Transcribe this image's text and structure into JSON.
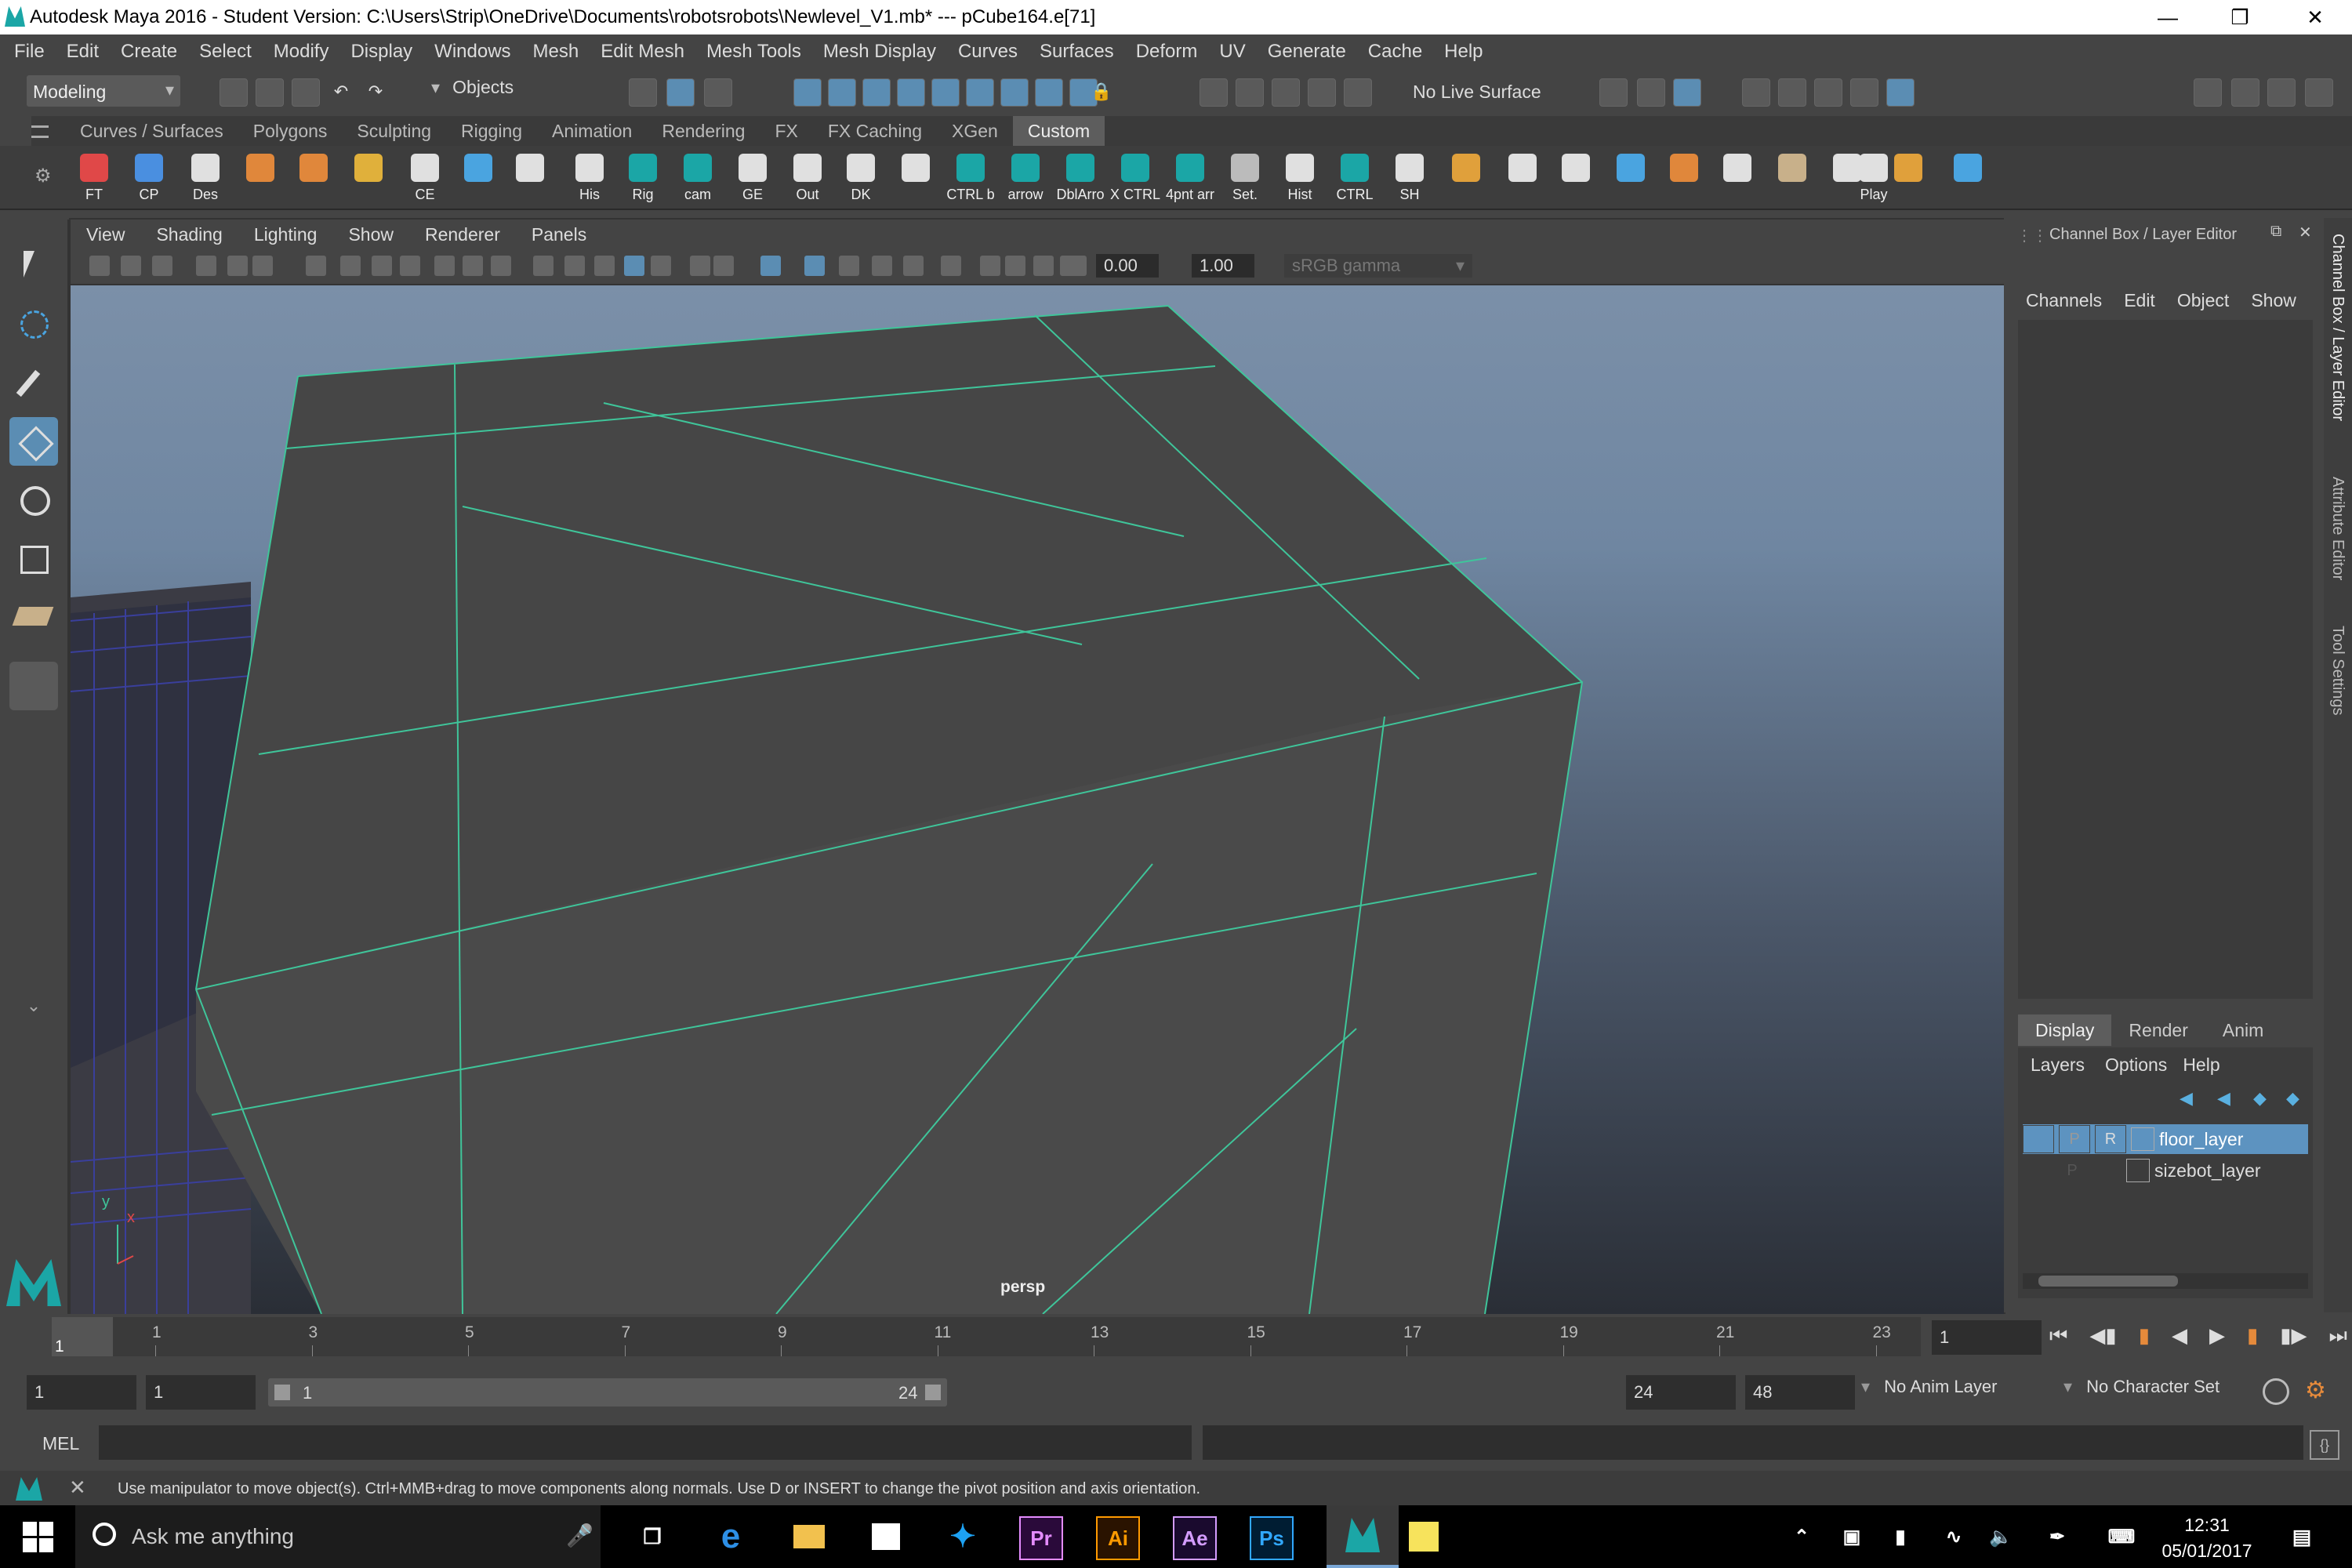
{
  "window": {
    "title": "Autodesk Maya 2016 - Student Version: C:\\Users\\Strip\\OneDrive\\Documents\\robotsrobots\\Newlevel_V1.mb*   ---   pCube164.e[71]"
  },
  "menubar": [
    "File",
    "Edit",
    "Create",
    "Select",
    "Modify",
    "Display",
    "Windows",
    "Mesh",
    "Edit Mesh",
    "Mesh Tools",
    "Mesh Display",
    "Curves",
    "Surfaces",
    "Deform",
    "UV",
    "Generate",
    "Cache",
    "Help"
  ],
  "status_line": {
    "mode": "Modeling",
    "selection_mode": "Objects",
    "live_surface": "No Live Surface"
  },
  "shelf_tabs": [
    "Curves / Surfaces",
    "Polygons",
    "Sculpting",
    "Rigging",
    "Animation",
    "Rendering",
    "FX",
    "FX Caching",
    "XGen",
    "Custom"
  ],
  "shelf_tabs_active": "Custom",
  "shelf_buttons": [
    "FT",
    "CP",
    "Des",
    "",
    "",
    "",
    "CE",
    "",
    "",
    "His",
    "Rig",
    "cam",
    "GE",
    "Out",
    "DK",
    "",
    "CTRL b",
    "arrow",
    "DblArro",
    "X CTRL",
    "4pnt arr",
    "Set.",
    "Hist",
    "CTRL",
    "SH",
    "",
    "",
    "",
    "",
    "",
    "",
    "",
    "",
    "Play",
    "",
    ""
  ],
  "viewport": {
    "menu": [
      "View",
      "Shading",
      "Lighting",
      "Show",
      "Renderer",
      "Panels"
    ],
    "exposure": "0.00",
    "gamma": "1.00",
    "color_space": "sRGB gamma",
    "camera_label": "persp",
    "axis_y": "y",
    "axis_x": "x"
  },
  "channel_box": {
    "title": "Channel Box / Layer Editor",
    "menu": [
      "Channels",
      "Edit",
      "Object",
      "Show"
    ],
    "layer_tabs": [
      "Display",
      "Render",
      "Anim"
    ],
    "layer_tabs_active": "Display",
    "layer_menu": [
      "Layers",
      "Options",
      "Help"
    ],
    "layers": [
      {
        "v": "",
        "p": "P",
        "r": "R",
        "name": "floor_layer",
        "selected": true
      },
      {
        "v": "",
        "p": "P",
        "r": "",
        "name": "sizebot_layer",
        "selected": false
      }
    ]
  },
  "side_tabs": [
    "Channel Box / Layer Editor",
    "Attribute Editor",
    "Tool Settings"
  ],
  "timeline": {
    "ticks": [
      "1",
      "3",
      "5",
      "7",
      "9",
      "11",
      "13",
      "15",
      "17",
      "19",
      "21",
      "23"
    ],
    "current_frame_marker": "1",
    "current_frame": "1"
  },
  "range": {
    "start": "1",
    "playback_start": "1",
    "slider_start": "1",
    "slider_end": "24",
    "playback_end": "24",
    "end": "48",
    "anim_layer": "No Anim Layer",
    "character_set": "No Character Set"
  },
  "command_line": {
    "label": "MEL"
  },
  "help_line": "Use manipulator to move object(s). Ctrl+MMB+drag to move components along normals. Use D or INSERT to change the pivot position and axis orientation.",
  "taskbar": {
    "search": "Ask me anything",
    "time": "12:31",
    "date": "05/01/2017",
    "apps": [
      "Pr",
      "Ai",
      "Ae",
      "Ps"
    ]
  }
}
